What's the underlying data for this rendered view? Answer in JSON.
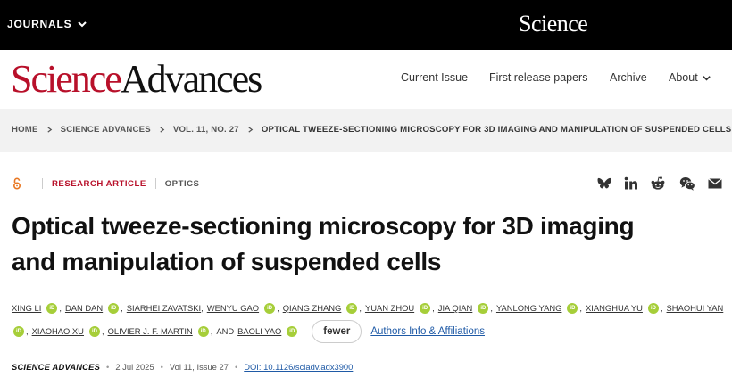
{
  "topbar": {
    "journals_label": "JOURNALS",
    "science_logo": "Science"
  },
  "brand": {
    "part1": "Science",
    "part2": "Advances"
  },
  "nav": {
    "current_issue": "Current Issue",
    "first_release": "First release papers",
    "archive": "Archive",
    "about": "About"
  },
  "breadcrumb": [
    "HOME",
    "SCIENCE ADVANCES",
    "VOL. 11, NO. 27",
    "OPTICAL TWEEZE-SECTIONING MICROSCOPY FOR 3D IMAGING AND MANIPULATION OF SUSPENDED CELLS"
  ],
  "article": {
    "type": "RESEARCH ARTICLE",
    "subject": "OPTICS",
    "title_line1": "Optical tweeze-sectioning microscopy for 3D imaging",
    "title_line2": "and manipulation of suspended cells",
    "authors": [
      "XING LI",
      "DAN DAN",
      "SIARHEI ZAVATSKI",
      "WENYU GAO",
      "QIANG ZHANG",
      "YUAN ZHOU",
      "JIA QIAN",
      "YANLONG YANG",
      "XIANGHUA YU",
      "SHAOHUI YAN",
      "XIAOHAO XU",
      "OLIVIER J. F. MARTIN",
      "BAOLI YAO"
    ],
    "and_label": "AND",
    "fewer_label": "fewer",
    "affiliations_label": "Authors Info & Affiliations",
    "orcid_label": "iD",
    "journal": "SCIENCE ADVANCES",
    "date": "2 Jul 2025",
    "volume": "Vol 11, Issue 27",
    "doi": "DOI: 10.1126/sciadv.adx3900"
  },
  "icons": {
    "open_access": "open-access-icon",
    "share": [
      "bluesky-icon",
      "linkedin-icon",
      "reddit-icon",
      "wechat-icon",
      "email-icon"
    ]
  },
  "colors": {
    "brand_red": "#b8102a",
    "link_blue": "#1f5aa6",
    "orcid_green": "#a6ce39",
    "open_access_orange": "#e87722"
  }
}
